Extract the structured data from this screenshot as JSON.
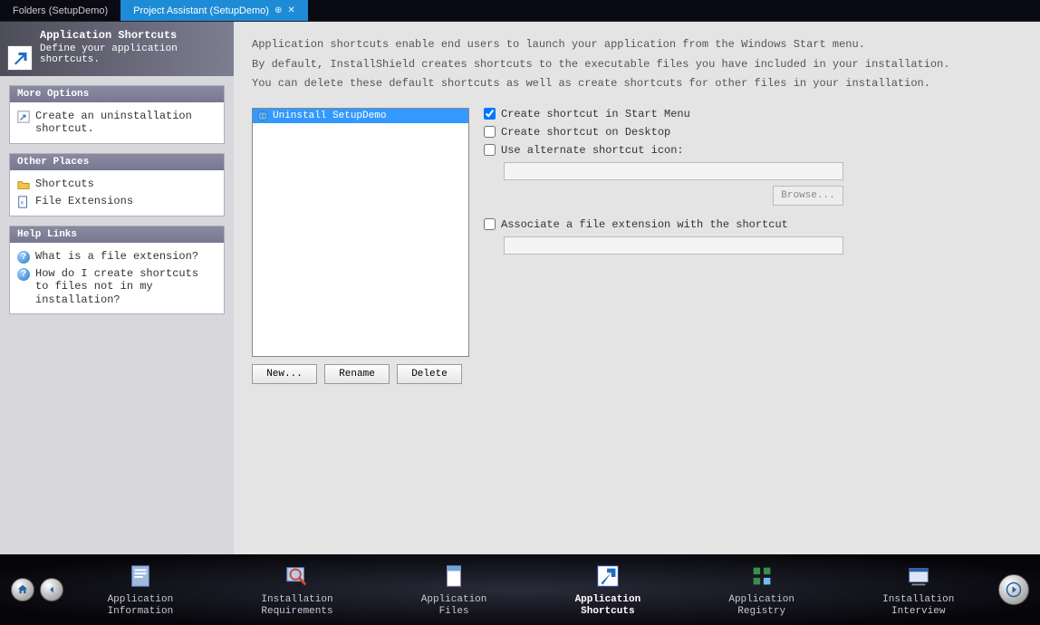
{
  "tabs": {
    "inactive": "Folders (SetupDemo)",
    "active": "Project Assistant (SetupDemo)"
  },
  "sidebar": {
    "header_title": "Application Shortcuts",
    "header_sub": "Define your application shortcuts.",
    "panels": {
      "more_options": {
        "title": "More Options",
        "item0": "Create an uninstallation shortcut."
      },
      "other_places": {
        "title": "Other Places",
        "item0": "Shortcuts",
        "item1": "File Extensions"
      },
      "help_links": {
        "title": "Help Links",
        "item0": "What is a file extension?",
        "item1": "How do I create shortcuts to files not in my installation?"
      }
    }
  },
  "content": {
    "intro1": "Application shortcuts enable end users to launch your application from the Windows Start menu.",
    "intro2a": "By default, InstallShield creates shortcuts to the executable files you have included in your installation.",
    "intro2b": "You can delete these default shortcuts as well as create shortcuts for other files in your installation.",
    "shortcut_item": "Uninstall SetupDemo",
    "buttons": {
      "new": "New...",
      "rename": "Rename",
      "delete": "Delete"
    },
    "options": {
      "start_menu": "Create shortcut in Start Menu",
      "desktop": "Create shortcut on Desktop",
      "alt_icon": "Use alternate shortcut icon:",
      "browse": "Browse...",
      "associate": "Associate a file extension with the shortcut"
    }
  },
  "nav": {
    "step0a": "Application",
    "step0b": "Information",
    "step1a": "Installation",
    "step1b": "Requirements",
    "step2a": "Application",
    "step2b": "Files",
    "step3a": "Application",
    "step3b": "Shortcuts",
    "step4a": "Application",
    "step4b": "Registry",
    "step5a": "Installation",
    "step5b": "Interview"
  }
}
